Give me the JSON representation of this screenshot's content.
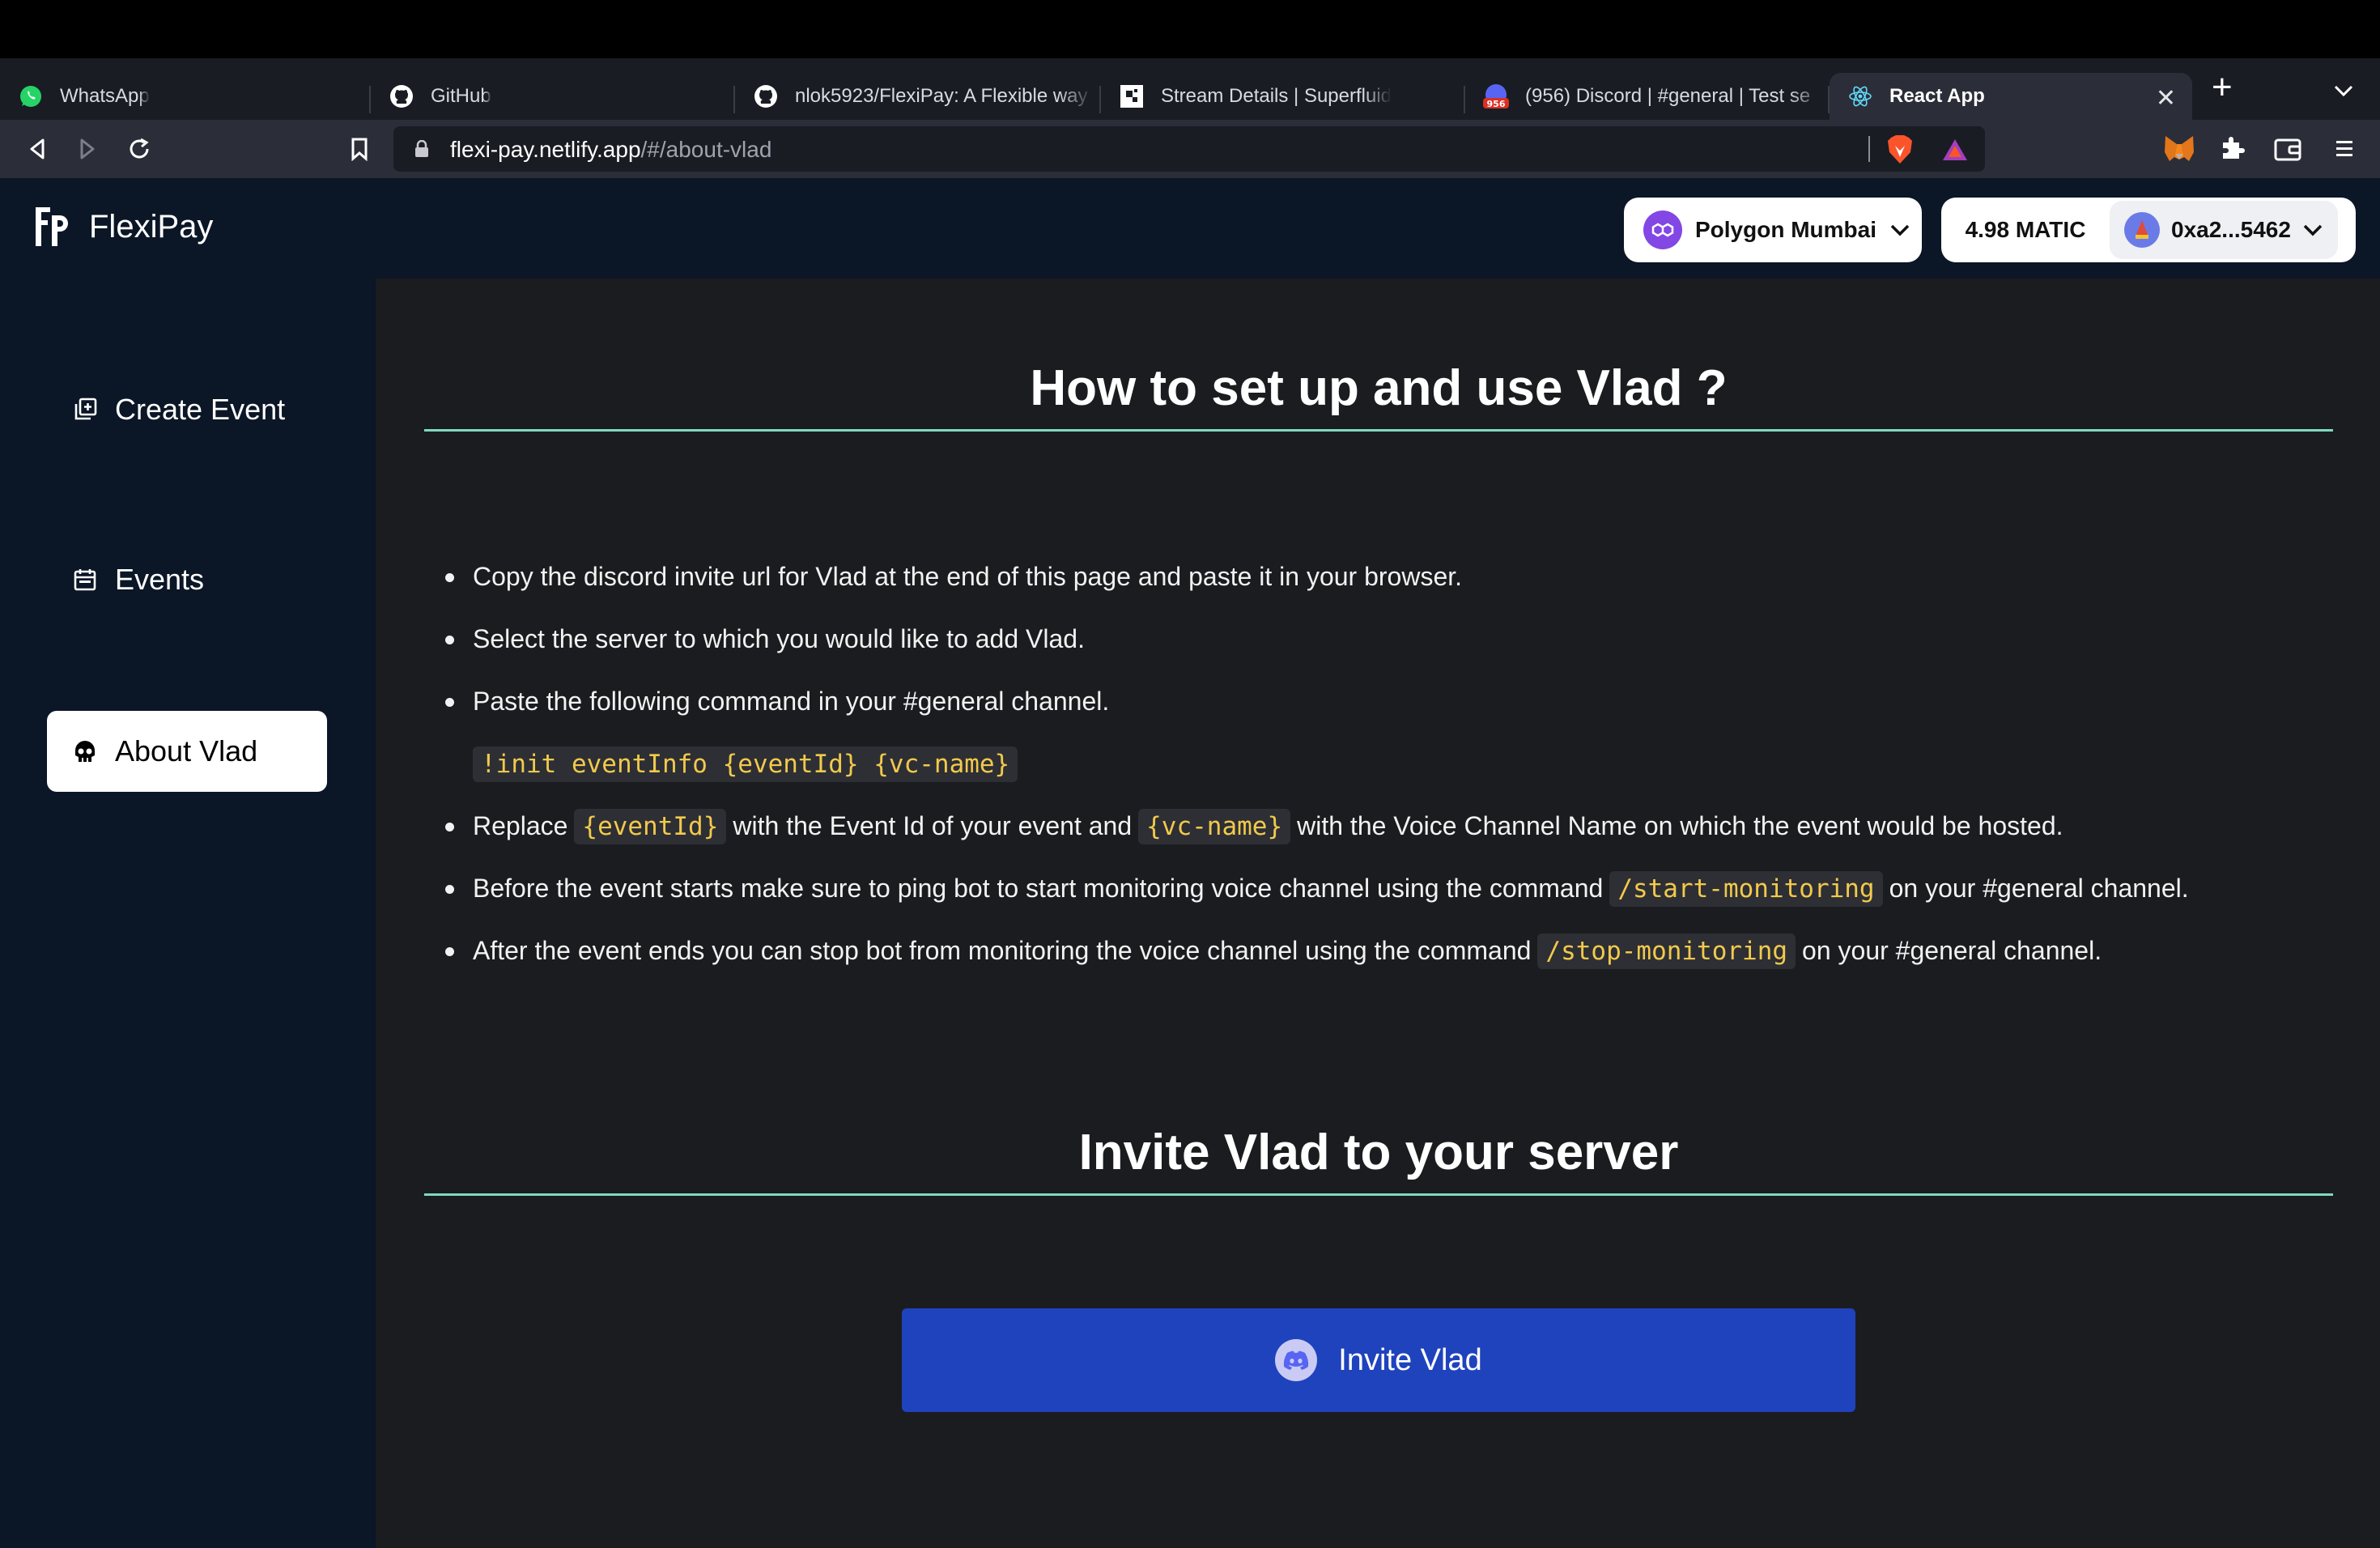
{
  "browser": {
    "tabs": [
      {
        "label": "WhatsApp",
        "icon": "whatsapp-icon"
      },
      {
        "label": "GitHub",
        "icon": "github-icon"
      },
      {
        "label": "nlok5923/FlexiPay: A Flexible way",
        "icon": "github-icon"
      },
      {
        "label": "Stream Details | Superfluid",
        "icon": "superfluid-icon"
      },
      {
        "label": "(956) Discord | #general | Test se",
        "icon": "discord-icon",
        "badge": "956"
      },
      {
        "label": "React App",
        "icon": "react-icon",
        "active": true
      }
    ],
    "close_label": "✕",
    "new_tab_label": "+",
    "url_host": "flexi-pay.netlify.app",
    "url_path": "/#/about-vlad"
  },
  "app": {
    "brand": "FlexiPay",
    "network_label": "Polygon Mumbai",
    "balance": "4.98 MATIC",
    "account": "0xa2...5462"
  },
  "sidebar": {
    "items": [
      {
        "label": "Create Event",
        "icon": "add-box-icon"
      },
      {
        "label": "Events",
        "icon": "calendar-icon"
      },
      {
        "label": "About Vlad",
        "icon": "skull-icon",
        "active": true
      }
    ]
  },
  "main": {
    "setup_title": "How to set up and use Vlad ?",
    "steps": {
      "s1": "Copy the discord invite url for Vlad at the end of this page and paste it in your browser.",
      "s2": "Select the server to which you would like to add Vlad.",
      "s3": "Paste the following command in your #general channel.",
      "s3_code": "!init eventInfo {eventId} {vc-name}",
      "s4_a": "Replace",
      "s4_code1": "{eventId}",
      "s4_b": "with the Event Id of your event and",
      "s4_code2": "{vc-name}",
      "s4_c": "with the Voice Channel Name on which the event would be hosted.",
      "s5_a": "Before the event starts make sure to ping bot to start monitoring voice channel using the command",
      "s5_code": "/start-monitoring",
      "s5_b": "on your #general channel.",
      "s6_a": "After the event ends you can stop bot from monitoring the voice channel using the command",
      "s6_code": "/stop-monitoring",
      "s6_b": "on your #general channel."
    },
    "invite_title": "Invite Vlad to your server",
    "invite_button": "Invite Vlad"
  },
  "colors": {
    "accent_rule": "#7fd9c0",
    "invite_button": "#1f43bd",
    "code_text": "#f2c94c",
    "sidebar_bg": "#0b1626"
  }
}
